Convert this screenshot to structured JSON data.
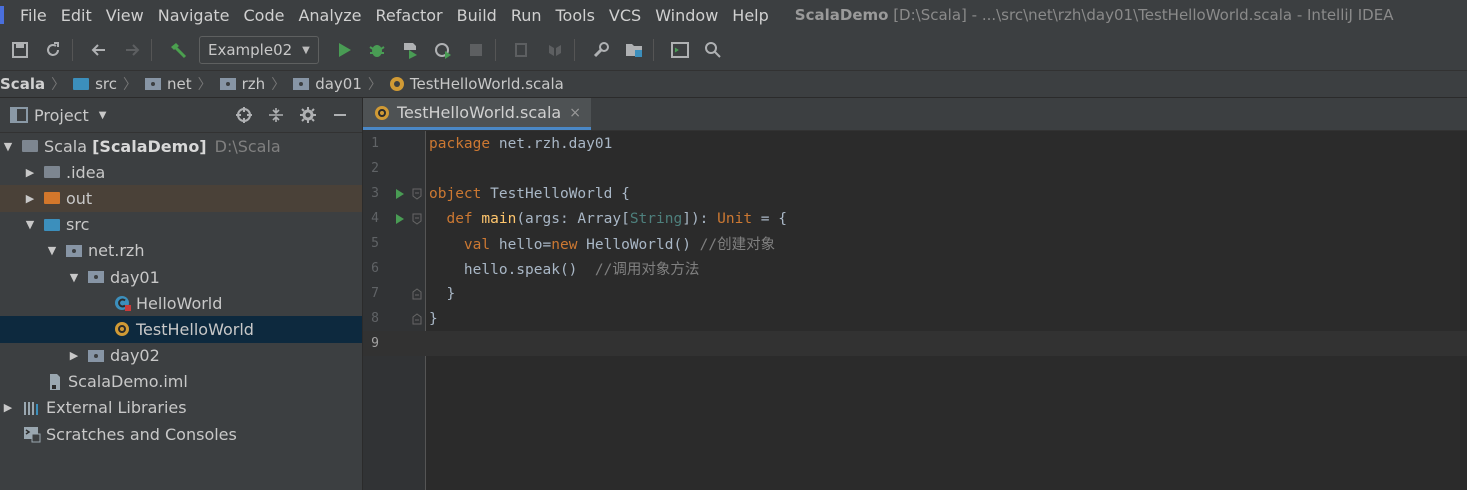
{
  "menu": {
    "items": [
      "File",
      "Edit",
      "View",
      "Navigate",
      "Code",
      "Analyze",
      "Refactor",
      "Build",
      "Run",
      "Tools",
      "VCS",
      "Window",
      "Help"
    ],
    "title_project": "ScalaDemo",
    "title_rest": " [D:\\Scala] - ...\\src\\net\\rzh\\day01\\TestHelloWorld.scala - IntelliJ IDEA"
  },
  "toolbar": {
    "run_config": "Example02"
  },
  "breadcrumb": {
    "items": [
      "Scala",
      "src",
      "net",
      "rzh",
      "day01",
      "TestHelloWorld.scala"
    ]
  },
  "sidebar": {
    "title": "Project",
    "tree": [
      {
        "label": "Scala",
        "bold": "[ScalaDemo]",
        "sub": "D:\\Scala"
      },
      {
        "label": ".idea"
      },
      {
        "label": "out"
      },
      {
        "label": "src"
      },
      {
        "label": "net.rzh"
      },
      {
        "label": "day01"
      },
      {
        "label": "HelloWorld"
      },
      {
        "label": "TestHelloWorld"
      },
      {
        "label": "day02"
      },
      {
        "label": "ScalaDemo.iml"
      },
      {
        "label": "External Libraries"
      },
      {
        "label": "Scratches and Consoles"
      }
    ]
  },
  "editor": {
    "tab_label": "TestHelloWorld.scala",
    "tab_close": "×",
    "line_numbers": [
      "1",
      "2",
      "3",
      "4",
      "5",
      "6",
      "7",
      "8",
      "9"
    ],
    "code": {
      "l1_kw": "package",
      "l1_rest": " net.rzh.day01",
      "l3_kw": "object",
      "l3_rest": " TestHelloWorld {",
      "l4_indent": "  ",
      "l4_kw": "def",
      "l4_sp": " ",
      "l4_fn": "main",
      "l4_a": "(args: Array[",
      "l4_ty": "String",
      "l4_b": "]): ",
      "l4_unit": "Unit",
      "l4_c": " = {",
      "l5_indent": "    ",
      "l5_kw": "val",
      "l5_a": " hello=",
      "l5_kw2": "new",
      "l5_b": " HelloWorld() ",
      "l5_cm": "//创建对象",
      "l6_indent": "    ",
      "l6_a": "hello.speak()  ",
      "l6_cm": "//调用对象方法",
      "l7": "  }",
      "l8": "}"
    }
  },
  "colors": {
    "accent_tab": "#4a88c7",
    "selection": "#0d293e",
    "keyword": "#cc7832",
    "function": "#ffc66d",
    "run_green": "#499c54"
  }
}
